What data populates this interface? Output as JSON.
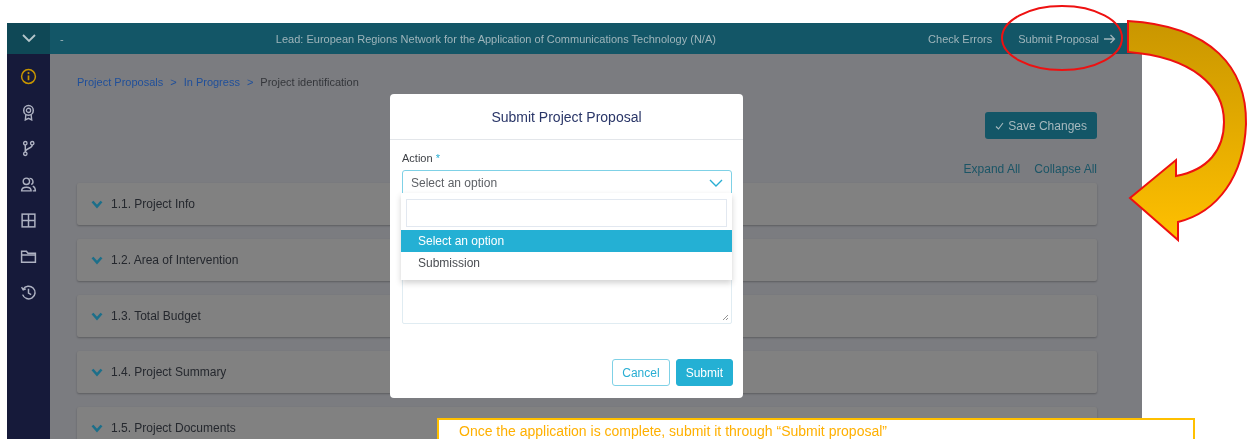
{
  "top_bar": {
    "dash": "-",
    "title": "Lead: European Regions Network for the Application of Communications Technology (N/A)",
    "check_errors": "Check Errors",
    "submit_proposal": "Submit Proposal"
  },
  "sidebar": {
    "items": [
      {
        "kind": "info",
        "selected": true
      },
      {
        "kind": "award",
        "selected": false
      },
      {
        "kind": "branch",
        "selected": false
      },
      {
        "kind": "users",
        "selected": false
      },
      {
        "kind": "grid",
        "selected": false
      },
      {
        "kind": "folder",
        "selected": false
      },
      {
        "kind": "history",
        "selected": false
      }
    ]
  },
  "breadcrumb": {
    "separator": ">",
    "items": [
      {
        "label": "Project Proposals",
        "link": true
      },
      {
        "label": "In Progress",
        "link": true
      },
      {
        "label": "Project identification",
        "link": false
      }
    ]
  },
  "toolbar": {
    "save_button": "Save Changes",
    "expand_all": "Expand All",
    "collapse_all": "Collapse All"
  },
  "sections": [
    {
      "label": "1.1. Project Info"
    },
    {
      "label": "1.2. Area of Intervention"
    },
    {
      "label": "1.3. Total Budget"
    },
    {
      "label": "1.4. Project Summary"
    },
    {
      "label": "1.5. Project Documents"
    }
  ],
  "modal": {
    "title": "Submit Project Proposal",
    "field_label": "Action",
    "required_mark": "*",
    "select_value": "Select an option",
    "options": [
      {
        "label": "Select an option",
        "selected": true
      },
      {
        "label": "Submission",
        "selected": false
      }
    ],
    "buttons": [
      {
        "label": "Cancel",
        "kind": "secondary"
      },
      {
        "label": "Submit",
        "kind": "primary"
      }
    ]
  },
  "annotation": {
    "callout_text": "Once the application is complete, submit it through “Submit proposal”"
  }
}
